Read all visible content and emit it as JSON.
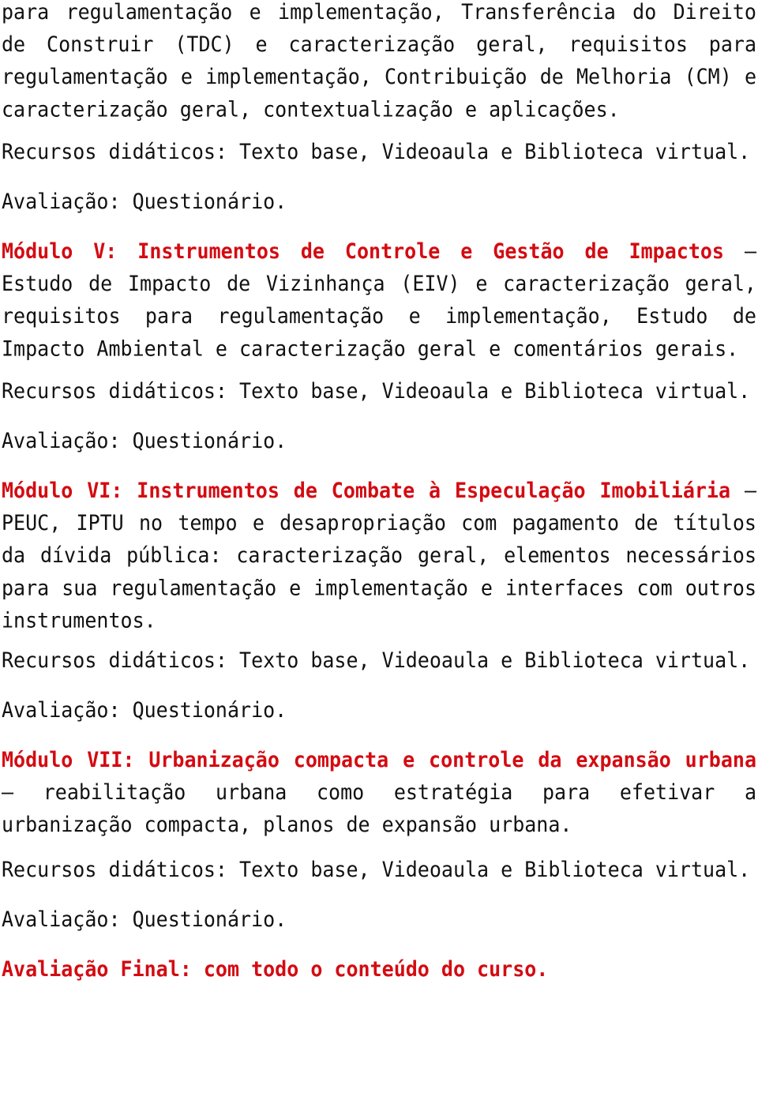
{
  "intro": {
    "text": "para regulamentação e implementação, Transferência do Direito de Construir (TDC) e caracterização geral, requisitos para regulamentação e implementação, Contribuição de Melhoria (CM) e caracterização geral, contextualização e aplicações."
  },
  "intro_resources": "Recursos didáticos: Texto base, Videoaula e Biblioteca virtual.",
  "intro_evaluation": "Avaliação: Questionário.",
  "modules": [
    {
      "title": "Módulo V: Instrumentos de Controle e Gestão de Impactos",
      "separator": " – ",
      "description": "Estudo de Impacto de Vizinhança (EIV) e caracterização geral, requisitos para regulamentação e implementação, Estudo de Impacto Ambiental e caracterização geral e comentários gerais.",
      "resources": "Recursos didáticos: Texto base, Videoaula e Biblioteca virtual.",
      "evaluation": "Avaliação: Questionário."
    },
    {
      "title": "Módulo VI: Instrumentos de Combate à Especulação Imobiliária",
      "separator": " – ",
      "description": "PEUC, IPTU no tempo e desapropriação com pagamento de títulos da dívida pública: caracterização geral, elementos necessários para sua regulamentação e implementação e interfaces com outros instrumentos.",
      "resources": "Recursos didáticos: Texto base, Videoaula e Biblioteca virtual.",
      "evaluation": "Avaliação: Questionário."
    },
    {
      "title": "Módulo VII: Urbanização compacta e controle da expansão urbana",
      "separator": " – ",
      "description": "reabilitação urbana como estratégia para efetivar a urbanização compacta, planos de expansão urbana.",
      "resources": "Recursos didáticos: Texto base, Videoaula e Biblioteca virtual.",
      "evaluation": "Avaliação: Questionário."
    }
  ],
  "final_evaluation": "Avaliação Final: com todo o conteúdo do curso.",
  "colors": {
    "heading": "#d40b12",
    "body_text": "#111111",
    "background": "#ffffff"
  }
}
